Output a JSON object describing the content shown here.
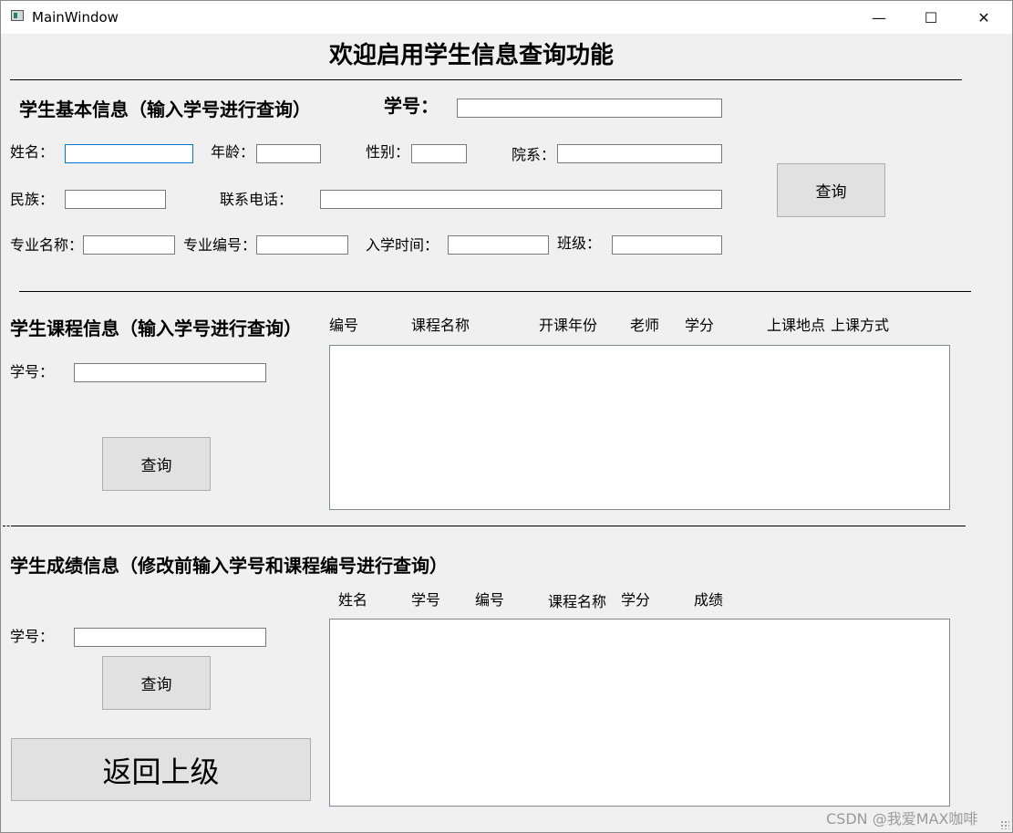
{
  "window": {
    "title": "MainWindow",
    "minimize_glyph": "—",
    "maximize_glyph": "☐",
    "close_glyph": "✕"
  },
  "page_title": "欢迎启用学生信息查询功能",
  "basic": {
    "heading": "学生基本信息（输入学号进行查询）",
    "student_id_label": "学号：",
    "fields": {
      "name": "姓名：",
      "age": "年龄：",
      "gender": "性别：",
      "department": "院系：",
      "ethnicity": "民族：",
      "phone": "联系电话：",
      "major_name": "专业名称：",
      "major_code": "专业编号：",
      "enroll_time": "入学时间：",
      "class": "班级："
    },
    "query_label": "查询"
  },
  "course": {
    "heading": "学生课程信息（输入学号进行查询）",
    "student_id_label": "学号：",
    "query_label": "查询",
    "columns": [
      "编号",
      "课程名称",
      "开课年份",
      "老师",
      "学分",
      "上课地点",
      "上课方式"
    ]
  },
  "grade": {
    "heading": "学生成绩信息（修改前输入学号和课程编号进行查询）",
    "student_id_label": "学号：",
    "query_label": "查询",
    "columns": [
      "姓名",
      "学号",
      "编号",
      "课程名称",
      "学分",
      "成绩"
    ]
  },
  "back_label": "返回上级",
  "watermark": "CSDN @我爱MAX咖啡"
}
